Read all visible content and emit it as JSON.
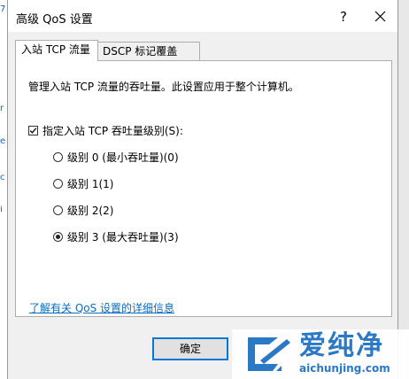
{
  "window": {
    "title": "高级 QoS 设置",
    "help_glyph": "?",
    "close_glyph": "✕"
  },
  "tabs": [
    {
      "label": "入站 TCP 流量",
      "active": true
    },
    {
      "label": "DSCP 标记覆盖",
      "active": false
    }
  ],
  "panel": {
    "description": "管理入站 TCP 流量的吞吐量。此设置应用于整个计算机。",
    "checkbox": {
      "label": "指定入站 TCP 吞吐量级别(S):",
      "checked": true
    },
    "radios": [
      {
        "label": "级别 0 (最小吞吐量)(0)",
        "selected": false
      },
      {
        "label": "级别 1(1)",
        "selected": false
      },
      {
        "label": "级别 2(2)",
        "selected": false
      },
      {
        "label": "级别 3 (最大吞吐量)(3)",
        "selected": true
      }
    ],
    "link": "了解有关 QoS 设置的详细信息"
  },
  "footer": {
    "ok_label": "确定"
  },
  "background": {
    "left_marks": [
      "7",
      "r",
      "e",
      "c",
      "i"
    ]
  },
  "watermark": {
    "title": "爱纯净",
    "url": "aichunjing.com",
    "color": "#2b78c5"
  },
  "colors": {
    "accent": "#0078d7",
    "link": "#0b6cbd"
  }
}
